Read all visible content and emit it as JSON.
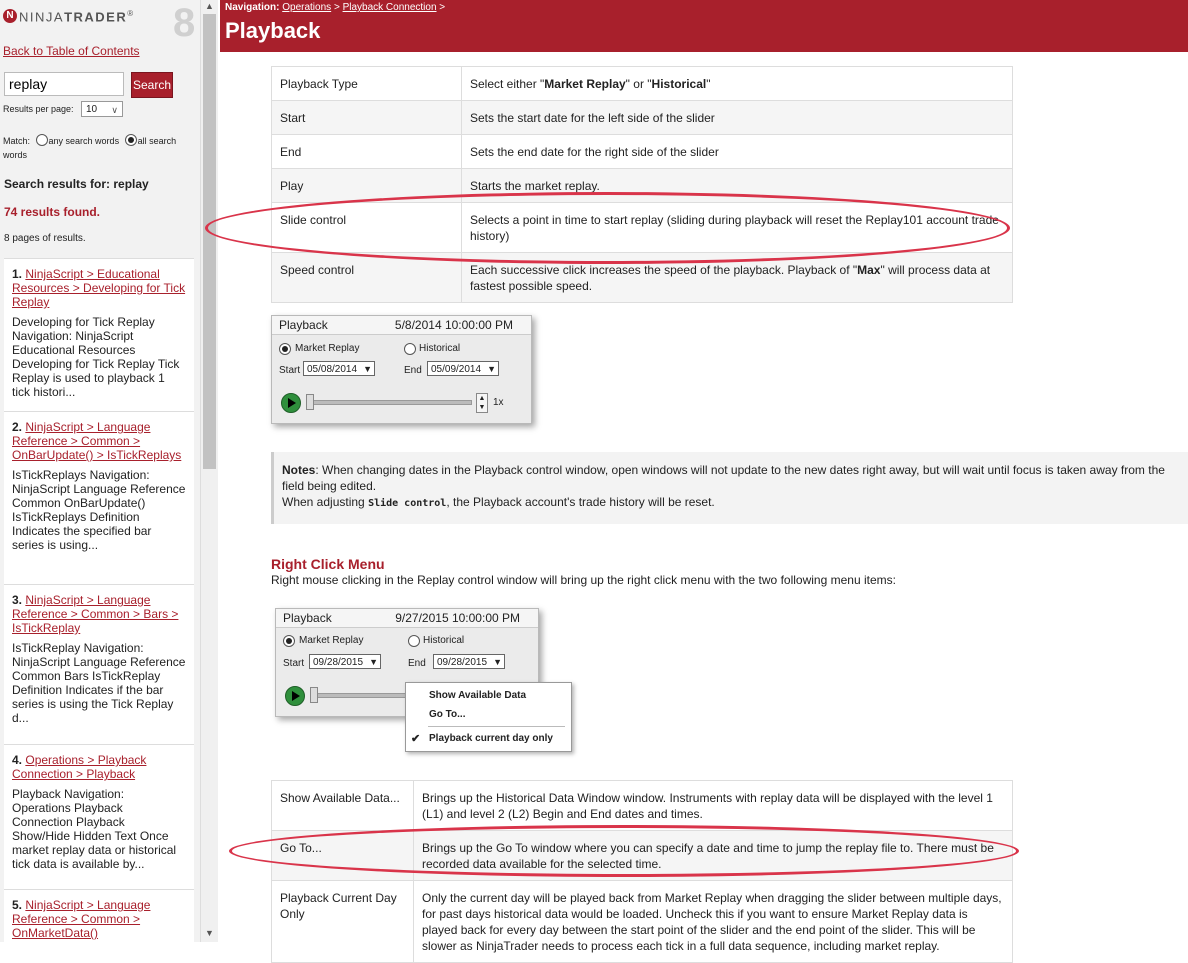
{
  "sidebar": {
    "logo": {
      "brand_left": "NINJA",
      "brand_right": "TRADER",
      "reg": "®",
      "version": "8"
    },
    "back_link": "Back to Table of Contents",
    "search": {
      "value": "replay",
      "button": "Search"
    },
    "results_per_page": {
      "label": "Results per page:",
      "value": "10"
    },
    "match": {
      "label": "Match:",
      "option_any": "any search words",
      "option_all": "all search words",
      "selected": "all search words"
    },
    "results_for": "Search results for: replay",
    "results_found": "74 results found.",
    "pages": "8 pages of results.",
    "results": [
      {
        "num": "1.",
        "title": "NinjaScript > Educational Resources > Developing for Tick Replay",
        "snippet": "Developing for Tick Replay Navigation: NinjaScript Educational Resources Developing for Tick Replay Tick Replay is used to playback 1 tick histori..."
      },
      {
        "num": "2.",
        "title": "NinjaScript > Language Reference > Common > OnBarUpdate() > IsTickReplays",
        "snippet": "IsTickReplays Navigation: NinjaScript Language Reference Common OnBarUpdate() IsTickReplays Definition Indicates the specified bar series is using..."
      },
      {
        "num": "3.",
        "title": "NinjaScript > Language Reference > Common > Bars > IsTickReplay",
        "snippet": "IsTickReplay Navigation: NinjaScript Language Reference Common Bars IsTickReplay Definition Indicates if the bar series is using the Tick Replay d..."
      },
      {
        "num": "4.",
        "title": "Operations > Playback Connection > Playback",
        "snippet": "Playback Navigation: Operations Playback Connection Playback Show/Hide Hidden Text Once market replay data or historical tick data is available by..."
      },
      {
        "num": "5.",
        "title": "NinjaScript > Language Reference > Common > OnMarketData()",
        "snippet": ""
      }
    ]
  },
  "header": {
    "nav_label": "Navigation:",
    "nav_link1": "Operations",
    "nav_sep": ">",
    "nav_link2": "Playback Connection",
    "nav_tail": ">",
    "title": "Playback"
  },
  "table1": [
    {
      "key": "Playback Type",
      "desc_pre": "Select either \"",
      "b1": "Market Replay",
      "desc_mid": "\" or \"",
      "b2": "Historical",
      "desc_post": "\""
    },
    {
      "key": "Start",
      "desc": "Sets the start date for the left side of the slider"
    },
    {
      "key": "End",
      "desc": "Sets the end date for the right side of the slider"
    },
    {
      "key": "Play",
      "desc": "Starts the market replay."
    },
    {
      "key": "Slide control",
      "desc": "Selects a point in time to start replay (sliding during playback will reset the Replay101 account trade history)"
    },
    {
      "key": "Speed control",
      "desc_pre": "Each successive click increases the speed of the playback. Playback of \"",
      "b1": "Max",
      "desc_post": "\" will process data at fastest possible speed."
    }
  ],
  "playback1": {
    "title": "Playback",
    "datetime": "5/8/2014 10:00:00 PM",
    "opt_market": "Market Replay",
    "opt_hist": "Historical",
    "start_label": "Start",
    "start": "05/08/2014",
    "end_label": "End",
    "end": "05/09/2014",
    "speed": "1x"
  },
  "notes": {
    "label": "Notes",
    "line1": ": When changing dates in the Playback control window, open windows will not update to the new dates right away, but will wait until focus is taken away from the field being edited.",
    "line2_pre": "When adjusting ",
    "line2_code": "Slide control",
    "line2_post": ", the Playback account's trade history will be reset."
  },
  "right_click": {
    "heading": "Right Click Menu",
    "desc": "Right mouse clicking in the Replay control window will bring up the right click menu with the two following menu items:"
  },
  "playback2": {
    "title": "Playback",
    "datetime": "9/27/2015 10:00:00 PM",
    "opt_market": "Market Replay",
    "opt_hist": "Historical",
    "start_label": "Start",
    "start": "09/28/2015",
    "end_label": "End",
    "end": "09/28/2015"
  },
  "context_menu": {
    "items": [
      "Show Available Data",
      "Go To...",
      "Playback current day only"
    ],
    "check": "✔"
  },
  "table2": [
    {
      "key": "Show Available Data...",
      "desc": "Brings up the Historical Data Window window. Instruments with replay data will be displayed with the level 1 (L1) and level 2 (L2) Begin and End dates and times."
    },
    {
      "key": "Go To...",
      "desc": "Brings up the Go To window where you can specify a date and time to jump the replay file to. There must be recorded data available for the selected time."
    },
    {
      "key": "Playback Current Day Only",
      "desc": "Only the current day will be played back from Market Replay when dragging the slider between multiple days, for past days historical data would be loaded. Uncheck this if you want to ensure Market Replay data is played back for every day between the start point of the slider and the end point of the slider. This will be slower as NinjaTrader needs to process each tick in a full data sequence, including market replay."
    }
  ],
  "colors": {
    "brand": "#a8202c",
    "highlight": "#d9344a",
    "play": "#2f8f3c"
  }
}
